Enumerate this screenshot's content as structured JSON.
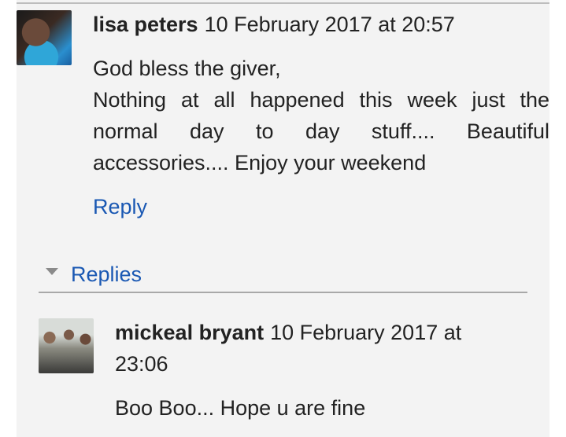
{
  "comment": {
    "author": "lisa peters",
    "timestamp": "10 February 2017 at 20:57",
    "line1": "God bless the giver,",
    "line2": "Nothing at all happened this week just the normal day to day stuff.... Beautiful accessories.... Enjoy your weekend",
    "reply_label": "Reply"
  },
  "replies": {
    "label": "Replies",
    "items": [
      {
        "author": "mickeal bryant",
        "timestamp_part1": "10 February 2017 at",
        "timestamp_part2": "23:06",
        "text": "Boo Boo... Hope u are fine"
      }
    ]
  }
}
